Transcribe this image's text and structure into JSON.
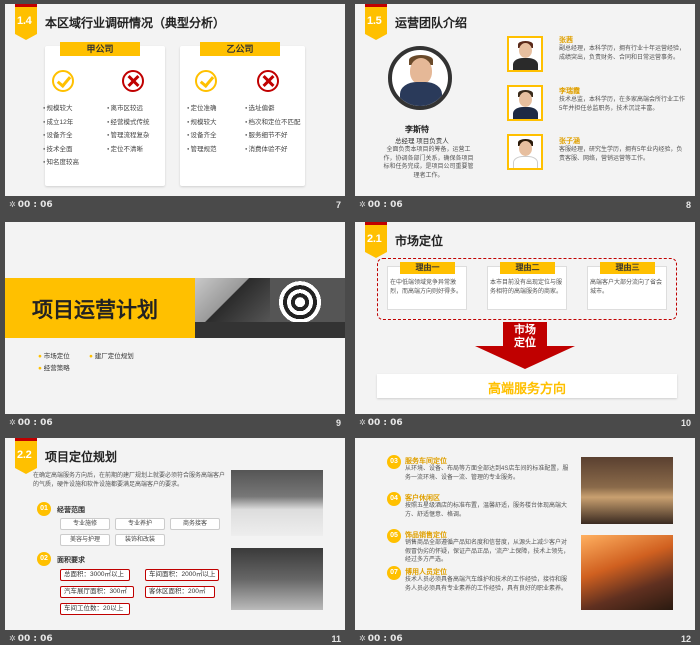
{
  "slides": [
    {
      "number": "7",
      "time": "00 : 06",
      "tag": "1.4",
      "title": "本区域行业调研情况（典型分析）",
      "companies": [
        {
          "name": "甲公司",
          "pros": [
            "规模较大",
            "成立12年",
            "设备齐全",
            "技术全面",
            "知名度较高"
          ],
          "cons": [
            "离市区较远",
            "经营模式传统",
            "管理流程复杂",
            "定位不清晰"
          ]
        },
        {
          "name": "乙公司",
          "pros": [
            "定位准确",
            "规模较大",
            "设备齐全",
            "管理规范"
          ],
          "cons": [
            "选址偏僻",
            "档次和定位不匹配",
            "服务细节不好",
            "消费体验不好"
          ]
        }
      ]
    },
    {
      "number": "8",
      "time": "00 : 06",
      "tag": "1.5",
      "title": "运营团队介绍",
      "leader": {
        "name": "李斯特",
        "role": "总经理  项目负责人",
        "desc": "全面负责本项目的筹备，运营工作，协调各部门关系，确保各项目标和任务完成，是项目公司重要管理者工作。"
      },
      "members": [
        {
          "name": "张茜",
          "desc": "副总经理，本科学历，拥有行业十年运营经验，成绩突出，负责财务、合同和日常运营事务。"
        },
        {
          "name": "李瑞霞",
          "desc": "技术总监，本科学历，在多家高端会所行业工作5年并担任总监职务，技术沉淀丰富。"
        },
        {
          "name": "张子涵",
          "desc": "客服经理，研究生学历，拥有5年业内经验，负责客服、网络，营销运营等工作。"
        }
      ]
    },
    {
      "number": "9",
      "time": "00 : 06",
      "title": "项目运营计划",
      "nav": [
        "市场定位",
        "建厂定位规划",
        "经营策略"
      ]
    },
    {
      "number": "10",
      "time": "00 : 06",
      "tag": "2.1",
      "title": "市场定位",
      "reasons": [
        {
          "label": "理由一",
          "text": "在中低端领域竞争异常激烈，而高端方向则好得多。"
        },
        {
          "label": "理由二",
          "text": "本市目前没有出现定位与服务相符的高端服务的商家。"
        },
        {
          "label": "理由三",
          "text": "高端客户大部分流向了省会城市。"
        }
      ],
      "arrow_label": "市场\n定位",
      "result": "高端服务方向"
    },
    {
      "number": "11",
      "time": "00 : 06",
      "tag": "2.2",
      "title": "项目定位规划",
      "intro": "在确定高端服务方向后，在前期的建厂规划上就要必须符合服务高端客户的气质，硬件设施和软件设施都要满足高端客户的要求。",
      "section1": {
        "num": "01",
        "title": "经营范围",
        "items": [
          "专业施修",
          "专业养护",
          "商务接客",
          "美容与护理",
          "装饰和改装"
        ]
      },
      "section2": {
        "num": "02",
        "title": "面积要求",
        "items": [
          "总面积：3000㎡以上",
          "车间面积：2000㎡以上",
          "汽车展厅面积：300㎡",
          "客休区面积：200㎡",
          "车间工位数：20以上"
        ]
      }
    },
    {
      "number": "12",
      "time": "00 : 06",
      "items": [
        {
          "num": "03",
          "title": "服务车间定位",
          "text": "从环境、设备、布局等方面全部达到4S店车间的标准配置，服务一流环境、设备一流、管理的专业服务。"
        },
        {
          "num": "04",
          "title": "客户休闲区",
          "text": "按照五星级酒店的标准布置，温馨舒适，服务楼台体现高端大方、舒适惬意、格调。"
        },
        {
          "num": "05",
          "title": "饰品销售定位",
          "text": "销售商品全部遵循产品知名度和信誉度，从源头上减少客户对假冒伪劣的怀疑，保证产品正品，'流产'上保障，技术上领先，经过多方严选。"
        },
        {
          "num": "07",
          "title": "博用人员定位",
          "text": "技术人员必须具备高端汽车维护和技术的工作经验，接待和服务人员必须具有专业素养的工作经验，具有良好的职业素养。"
        }
      ]
    }
  ]
}
